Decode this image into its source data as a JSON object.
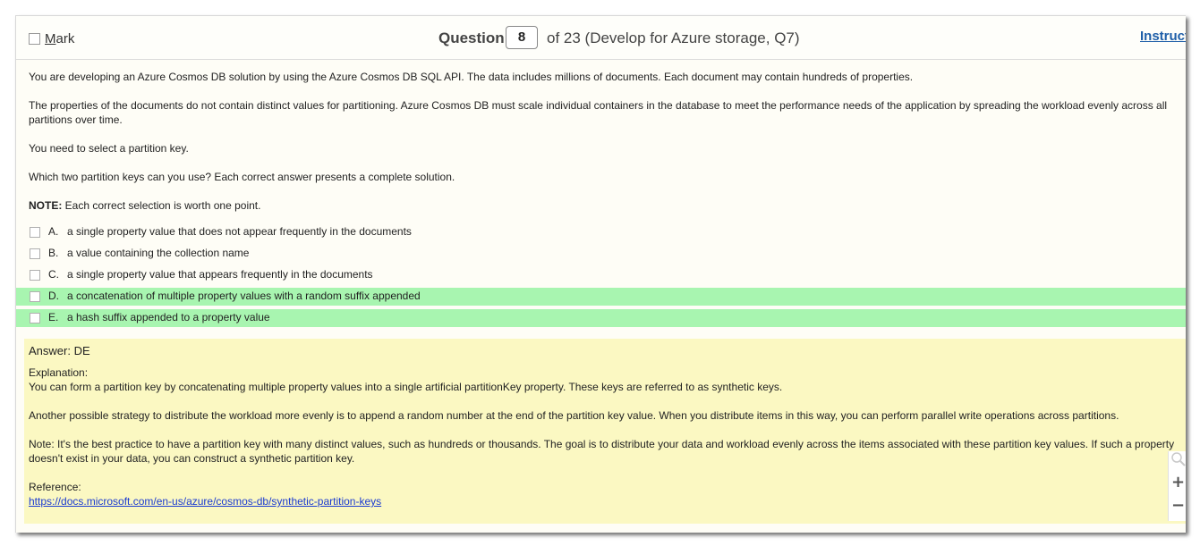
{
  "header": {
    "mark_label_first": "M",
    "mark_label_rest": "ark",
    "question_label": "Question",
    "question_number": "8",
    "question_of": "of 23 (Develop for Azure storage, Q7)",
    "instructions_label": "Instructions"
  },
  "question": {
    "paragraphs": [
      "You are developing an Azure Cosmos DB solution by using the Azure Cosmos DB SQL API. The data includes millions of documents. Each document may contain hundreds of properties.",
      "The properties of the documents do not contain distinct values for partitioning. Azure Cosmos DB must scale individual containers in the database to meet the performance needs of the application by spreading the workload evenly across all partitions over time.",
      "You need to select a partition key.",
      "Which two partition keys can you use? Each correct answer presents a complete solution."
    ],
    "note_label": "NOTE:",
    "note_text": " Each correct selection is worth one point."
  },
  "options": [
    {
      "letter": "A.",
      "text": "a single property value that does not appear frequently in the documents",
      "correct": false
    },
    {
      "letter": "B.",
      "text": "a value containing the collection name",
      "correct": false
    },
    {
      "letter": "C.",
      "text": "a single property value that appears frequently in the documents",
      "correct": false
    },
    {
      "letter": "D.",
      "text": "a concatenation of multiple property values with a random suffix appended",
      "correct": true
    },
    {
      "letter": "E.",
      "text": "a hash suffix appended to a property value",
      "correct": true
    }
  ],
  "answer": {
    "answer_line": "Answer: DE",
    "explanation_label": "Explanation:",
    "explanation_1": "You can form a partition key by concatenating multiple property values into a single artificial partitionKey property. These keys are referred to as synthetic keys.",
    "explanation_2": "Another possible strategy to distribute the workload more evenly is to append a random number at the end of the partition key value. When you distribute items in this way, you can perform parallel write operations across partitions.",
    "explanation_3": "Note: It's the best practice to have a partition key with many distinct values, such as hundreds or thousands. The goal is to distribute your data and workload evenly across the items associated with these partition key values. If such a property doesn't exist in your data, you can construct a synthetic partition key.",
    "reference_label": "Reference:",
    "reference_url": "https://docs.microsoft.com/en-us/azure/cosmos-db/synthetic-partition-keys"
  },
  "zoom": {
    "magnifier_icon": "magnifier-icon",
    "zoom_in_label": "+",
    "zoom_out_label": "−"
  },
  "colors": {
    "correct_highlight": "#a8f5b0",
    "answer_background": "#fbf8c2",
    "link": "#1a3ad1"
  }
}
